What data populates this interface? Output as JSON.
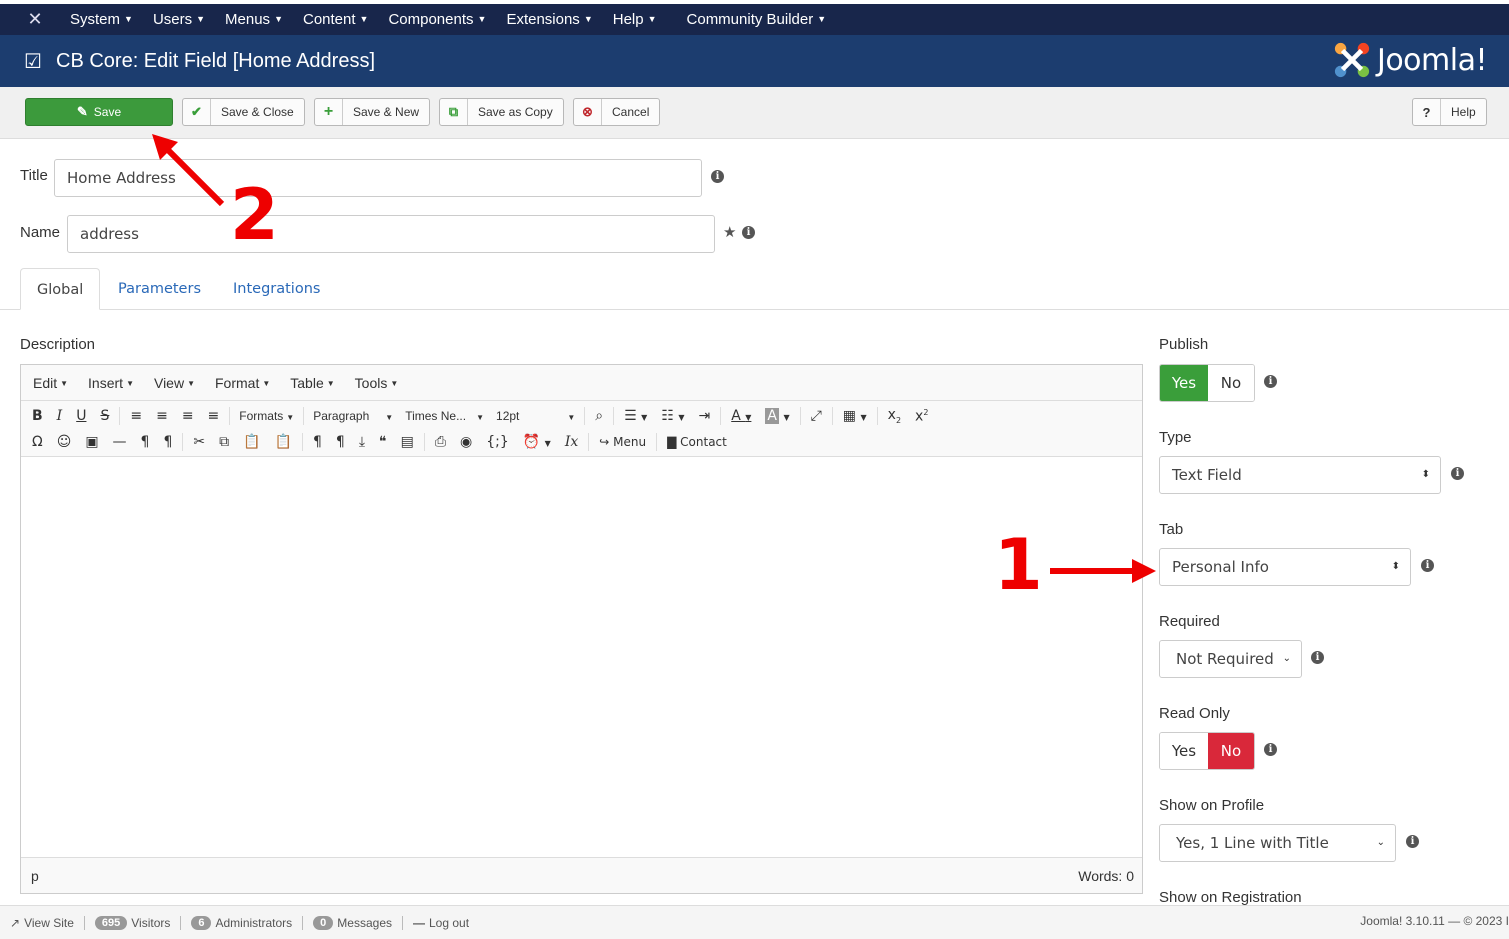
{
  "topmenu": {
    "system": "System",
    "users": "Users",
    "menus": "Menus",
    "content": "Content",
    "components": "Components",
    "extensions": "Extensions",
    "help": "Help",
    "cb": "Community Builder"
  },
  "header": {
    "title": "CB Core: Edit Field [Home Address]",
    "brand": "Joomla!"
  },
  "toolbar": {
    "save": "Save",
    "save_close": "Save & Close",
    "save_new": "Save & New",
    "save_copy": "Save as Copy",
    "cancel": "Cancel",
    "help": "Help"
  },
  "form": {
    "title_label": "Title",
    "title_value": "Home Address",
    "name_label": "Name",
    "name_value": "address"
  },
  "tabs": {
    "global": "Global",
    "parameters": "Parameters",
    "integrations": "Integrations"
  },
  "description": {
    "label": "Description",
    "menus": {
      "edit": "Edit",
      "insert": "Insert",
      "view": "View",
      "format": "Format",
      "table": "Table",
      "tools": "Tools"
    },
    "formats": "Formats",
    "paragraph": "Paragraph",
    "font": "Times Ne...",
    "size": "12pt",
    "menu_btn": "Menu",
    "contact_btn": "Contact",
    "path": "p",
    "words": "Words: 0"
  },
  "right": {
    "publish_label": "Publish",
    "publish_yes": "Yes",
    "publish_no": "No",
    "type_label": "Type",
    "type_value": "Text Field",
    "tab_label": "Tab",
    "tab_value": "Personal Info",
    "required_label": "Required",
    "required_value": "Not Required",
    "readonly_label": "Read Only",
    "readonly_yes": "Yes",
    "readonly_no": "No",
    "profile_label": "Show on Profile",
    "profile_value": "Yes, 1 Line with Title",
    "registration_label": "Show on Registration"
  },
  "annotations": {
    "one": "1",
    "two": "2"
  },
  "statusbar": {
    "view_site": "View Site",
    "visitors_count": "695",
    "visitors": "Visitors",
    "admins_count": "6",
    "admins": "Administrators",
    "messages_count": "0",
    "messages": "Messages",
    "logout": "Log out",
    "version": "Joomla! 3.10.11 — © 2023 I"
  },
  "colors": {
    "topbar": "#18264b",
    "header": "#1c3d6f",
    "save": "#3c9a3c",
    "yes_active": "#3a9e3a",
    "no_active": "#d9283a",
    "annotation": "#e00000",
    "link": "#2a69b8"
  }
}
